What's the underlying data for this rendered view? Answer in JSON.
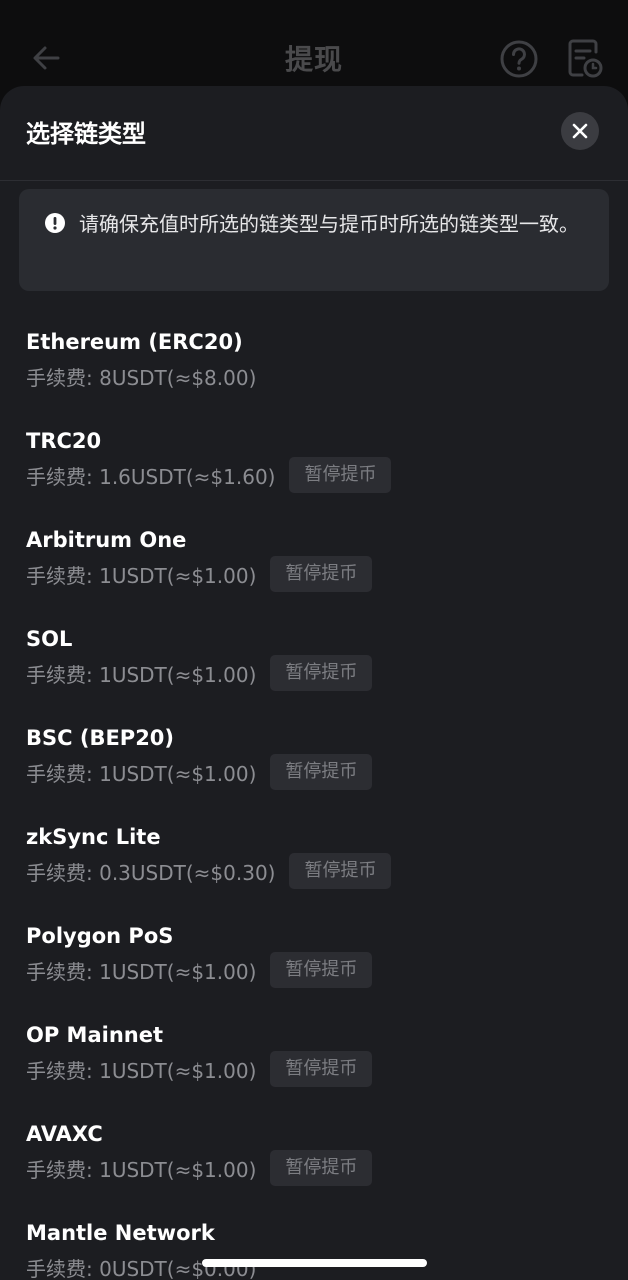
{
  "header": {
    "title": "提现"
  },
  "sheet": {
    "title": "选择链类型",
    "notice": "请确保充值时所选的链类型与提币时所选的链类型一致。"
  },
  "chains": [
    {
      "name": "Ethereum (ERC20)",
      "fee": "手续费: 8USDT(≈$8.00)",
      "badge": ""
    },
    {
      "name": "TRC20",
      "fee": "手续费: 1.6USDT(≈$1.60)",
      "badge": "暂停提币"
    },
    {
      "name": "Arbitrum One",
      "fee": "手续费: 1USDT(≈$1.00)",
      "badge": "暂停提币"
    },
    {
      "name": "SOL",
      "fee": "手续费: 1USDT(≈$1.00)",
      "badge": "暂停提币"
    },
    {
      "name": "BSC (BEP20)",
      "fee": "手续费: 1USDT(≈$1.00)",
      "badge": "暂停提币"
    },
    {
      "name": "zkSync Lite",
      "fee": "手续费: 0.3USDT(≈$0.30)",
      "badge": "暂停提币"
    },
    {
      "name": "Polygon PoS",
      "fee": "手续费: 1USDT(≈$1.00)",
      "badge": "暂停提币"
    },
    {
      "name": "OP Mainnet",
      "fee": "手续费: 1USDT(≈$1.00)",
      "badge": "暂停提币"
    },
    {
      "name": "AVAXC",
      "fee": "手续费: 1USDT(≈$1.00)",
      "badge": "暂停提币"
    },
    {
      "name": "Mantle Network",
      "fee": "手续费: 0USDT(≈$0.00)",
      "badge": ""
    }
  ],
  "colors": {
    "sheet_bg": "#1c1d21",
    "notice_bg": "#2a2c31",
    "badge_bg": "#2c2d32"
  },
  "icons": [
    "back-arrow-icon",
    "help-icon",
    "record-icon",
    "close-icon",
    "info-icon"
  ]
}
